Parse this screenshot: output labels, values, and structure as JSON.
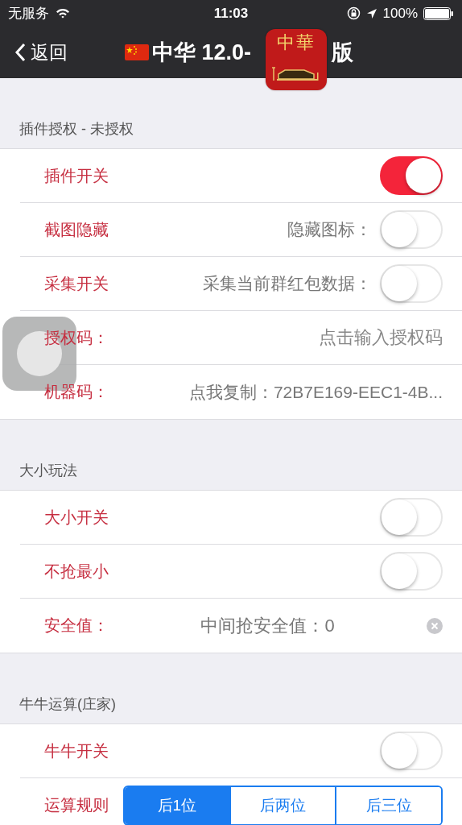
{
  "status_bar": {
    "carrier": "无服务",
    "time": "11:03",
    "battery": "100%"
  },
  "nav_bar": {
    "back": "返回",
    "title_start": "中华 12.0-",
    "title_end": "版",
    "app_icon_text": "中華"
  },
  "sections": [
    {
      "header": "插件授权 - 未授权",
      "rows": [
        {
          "kind": "switch",
          "label": "插件开关",
          "on": true
        },
        {
          "kind": "switch",
          "label": "截图隐藏",
          "detail": "隐藏图标：",
          "on": false
        },
        {
          "kind": "switch",
          "label": "采集开关",
          "detail": "采集当前群红包数据：",
          "on": false
        },
        {
          "kind": "input",
          "label": "授权码：",
          "placeholder": "点击输入授权码"
        },
        {
          "kind": "copy",
          "label": "机器码：",
          "value": "点我复制：72B7E169-EEC1-4B..."
        }
      ]
    },
    {
      "header": "大小玩法",
      "rows": [
        {
          "kind": "switch",
          "label": "大小开关",
          "on": false
        },
        {
          "kind": "switch",
          "label": "不抢最小",
          "on": false
        },
        {
          "kind": "input",
          "label": "安全值：",
          "value": "中间抢安全值：0",
          "clear_button": true
        }
      ]
    },
    {
      "header": "牛牛运算(庄家)",
      "rows": [
        {
          "kind": "switch",
          "label": "牛牛开关",
          "on": false
        },
        {
          "kind": "segmented",
          "label": "运算规则",
          "segments": [
            {
              "label": "后1位",
              "selected": true
            },
            {
              "label": "后两位",
              "selected": false
            },
            {
              "label": "后三位",
              "selected": false
            }
          ]
        }
      ]
    }
  ]
}
